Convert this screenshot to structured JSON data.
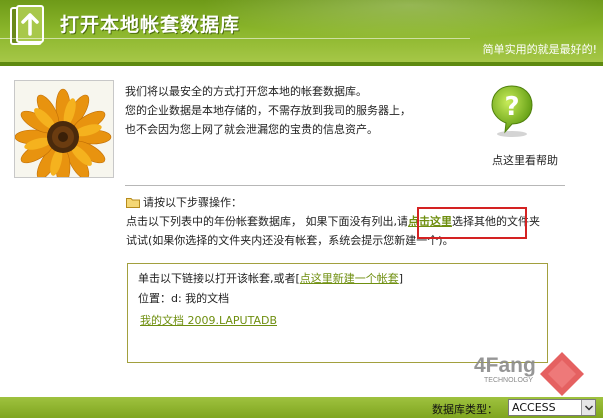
{
  "header": {
    "title": "打开本地帐套数据库",
    "slogan": "简单实用的就是最好的!"
  },
  "intro": {
    "lines": [
      "我们将以最安全的方式打开您本地的帐套数据库。",
      "您的企业数据是本地存储的，不需存放到我司的服务器上，",
      "也不会因为您上网了就会泄漏您的宝贵的信息资产。"
    ]
  },
  "help": {
    "label": "点这里看帮助",
    "icon": "question-mark-bubble-icon"
  },
  "steps": {
    "heading": "请按以下步骤操作：",
    "line1_before": "点击以下列表中的年份帐套数据库，  如果下面没有列出,请",
    "link": "点击这里",
    "line1_after": "选择其他的文件夹",
    "line2": "试试(如果你选择的文件夹内还没有帐套，系统会提示您新建一个)。"
  },
  "panel": {
    "prompt": "单击以下链接以打开该帐套,或者[",
    "new_link": "点这里新建一个帐套",
    "prompt_end": "]",
    "location_label": "位置：",
    "location_value": "d: 我的文档",
    "file_link": "我的文档 2009.LAPUTADB"
  },
  "watermark": {
    "brand": "4Fang",
    "sub": "TECHNOLOGY"
  },
  "bottom": {
    "db_type_label": "数据库类型：",
    "db_type_value": "ACCESS"
  },
  "colors": {
    "header_green": "#8ab52a",
    "link_green": "#6f8f10",
    "highlight_red": "#d42222"
  }
}
